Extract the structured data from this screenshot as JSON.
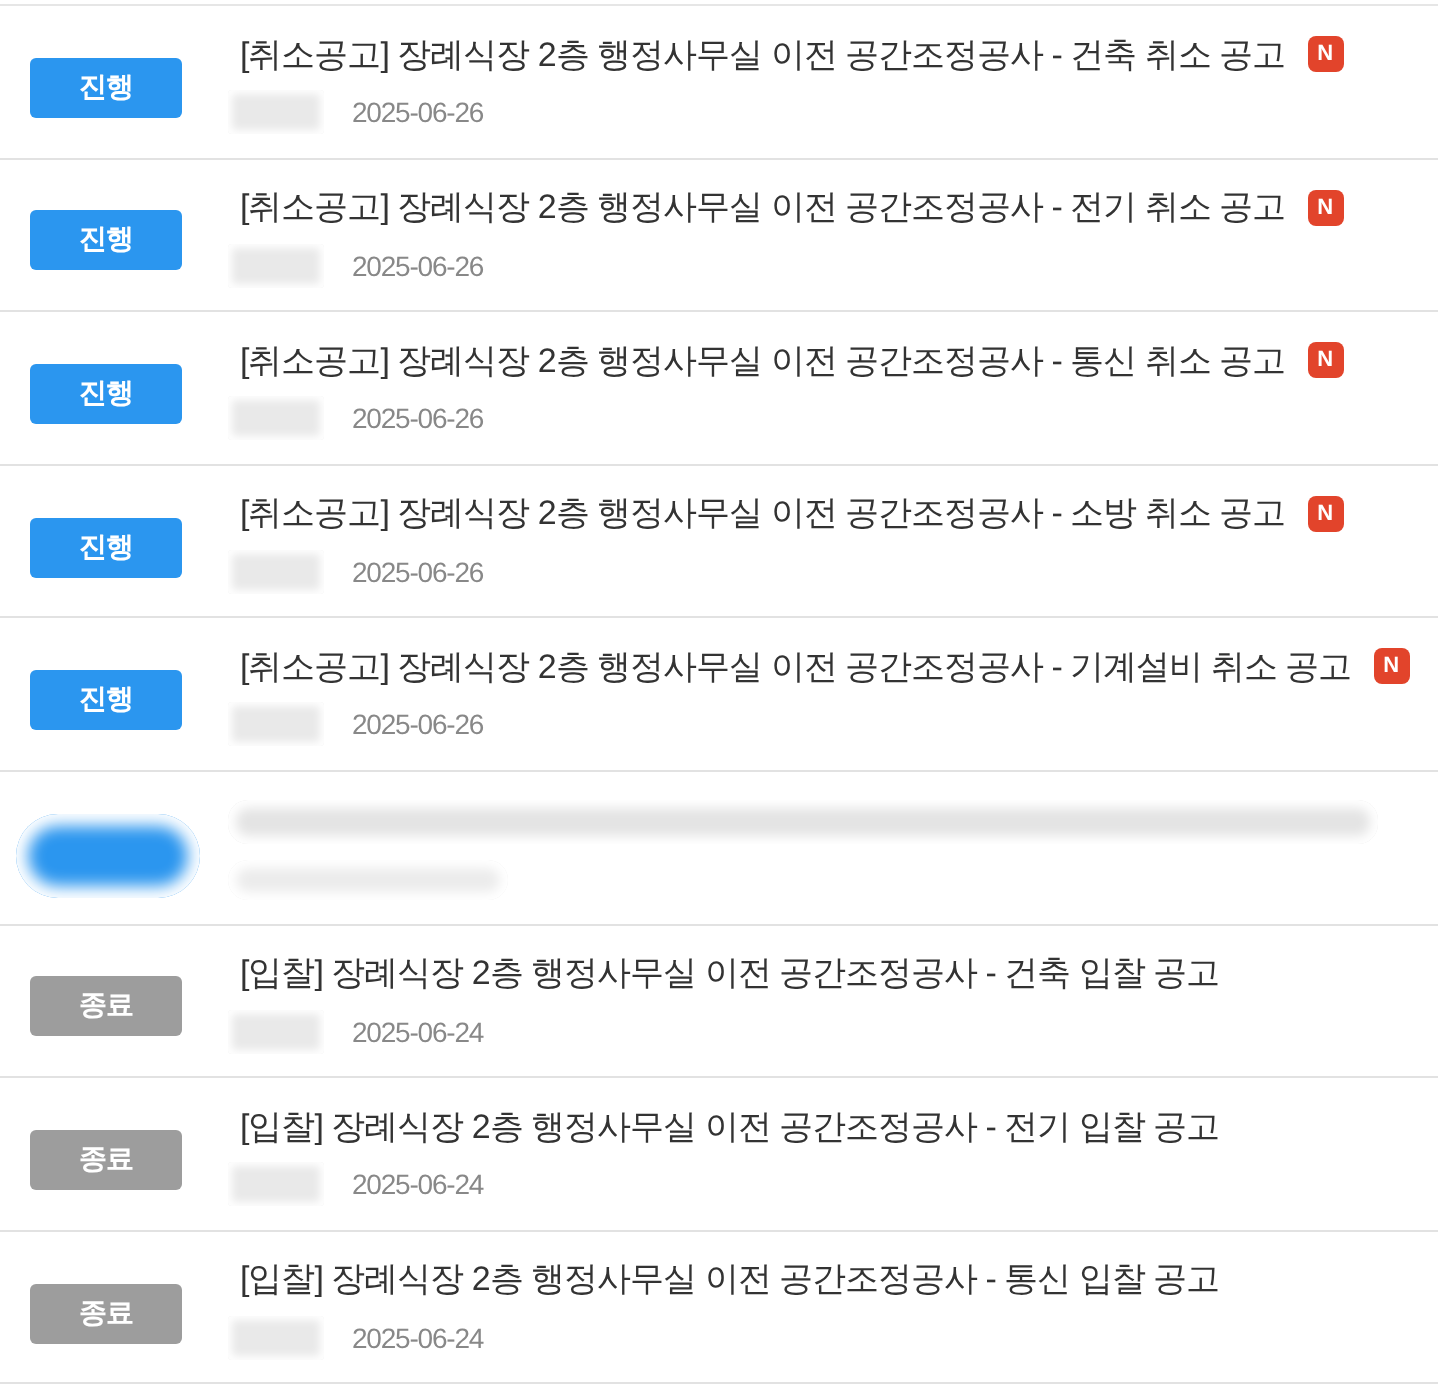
{
  "list": {
    "rows": [
      {
        "kind": "post",
        "active": true,
        "status_label": "진행",
        "title": "[취소공고] 장례식장 2층 행정사무실 이전 공간조정공사 - 건축 취소 공고",
        "badge": "N",
        "date": "2025-06-26"
      },
      {
        "kind": "post",
        "active": true,
        "status_label": "진행",
        "title": "[취소공고] 장례식장 2층 행정사무실 이전 공간조정공사 - 전기 취소 공고",
        "badge": "N",
        "date": "2025-06-26"
      },
      {
        "kind": "post",
        "active": true,
        "status_label": "진행",
        "title": "[취소공고] 장례식장 2층 행정사무실 이전 공간조정공사 - 통신 취소 공고",
        "badge": "N",
        "date": "2025-06-26"
      },
      {
        "kind": "post",
        "active": true,
        "status_label": "진행",
        "title": "[취소공고] 장례식장 2층 행정사무실 이전 공간조정공사 - 소방 취소 공고",
        "badge": "N",
        "date": "2025-06-26"
      },
      {
        "kind": "post",
        "active": true,
        "status_label": "진행",
        "title": "[취소공고] 장례식장 2층 행정사무실 이전 공간조정공사 - 기계설비 취소 공고",
        "badge": "N",
        "date": "2025-06-26"
      },
      {
        "kind": "redacted",
        "active": true
      },
      {
        "kind": "post",
        "active": false,
        "status_label": "종료",
        "title": "[입찰] 장례식장 2층 행정사무실 이전 공간조정공사 - 건축 입찰 공고",
        "date": "2025-06-24"
      },
      {
        "kind": "post",
        "active": false,
        "status_label": "종료",
        "title": "[입찰] 장례식장 2층 행정사무실 이전 공간조정공사 - 전기 입찰 공고",
        "date": "2025-06-24"
      },
      {
        "kind": "post",
        "active": false,
        "status_label": "종료",
        "title": "[입찰] 장례식장 2층 행정사무실 이전 공간조정공사 - 통신 입찰 공고",
        "date": "2025-06-24"
      }
    ]
  }
}
